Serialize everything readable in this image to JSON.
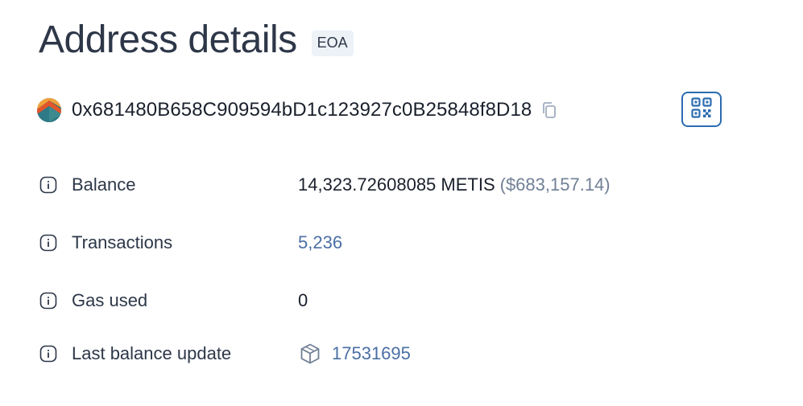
{
  "header": {
    "title": "Address details",
    "tag": "EOA"
  },
  "address": {
    "hash": "0x681480B658C909594bD1c123927c0B25848f8D18",
    "avatar_icon": "identicon",
    "copy_icon": "copy-icon",
    "qr_icon": "qr-code-icon"
  },
  "details": {
    "balance": {
      "label": "Balance",
      "value": "14,323.72608085 METIS",
      "usd": "($683,157.14)"
    },
    "transactions": {
      "label": "Transactions",
      "value": "5,236"
    },
    "gas_used": {
      "label": "Gas used",
      "value": "0"
    },
    "last_balance_update": {
      "label": "Last balance update",
      "value": "17531695",
      "icon": "block-icon"
    }
  },
  "colors": {
    "accent": "#2b6cb0",
    "link": "#4a6fa5",
    "muted": "#718096",
    "text": "#1a202c"
  }
}
